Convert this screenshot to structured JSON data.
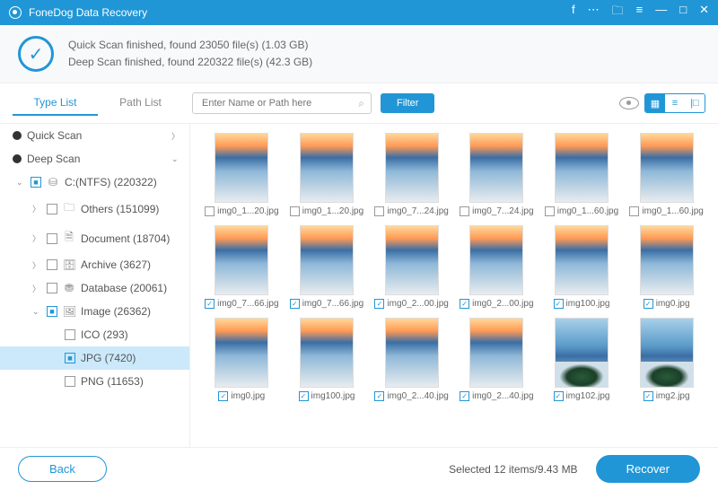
{
  "app": {
    "title": "FoneDog Data Recovery"
  },
  "titlebar_icons": [
    "facebook-icon",
    "feedback-icon",
    "save-icon",
    "menu-icon",
    "minimize-icon",
    "maximize-icon",
    "close-icon"
  ],
  "status": {
    "line1": "Quick Scan finished, found 23050 file(s) (1.03 GB)",
    "line2": "Deep Scan finished, found 220322 file(s) (42.3 GB)"
  },
  "tabs": {
    "type": "Type List",
    "path": "Path List"
  },
  "search": {
    "placeholder": "Enter Name or Path here"
  },
  "filter": "Filter",
  "sidebar": {
    "quick": "Quick Scan",
    "deep": "Deep Scan",
    "drive": "C:(NTFS) (220322)",
    "others": "Others (151099)",
    "document": "Document (18704)",
    "archive": "Archive (3627)",
    "database": "Database (20061)",
    "image": "Image (26362)",
    "ico": "ICO (293)",
    "jpg": "JPG (7420)",
    "png": "PNG (11653)"
  },
  "files": [
    {
      "name": "img0_1...20.jpg",
      "checked": false,
      "alt": false
    },
    {
      "name": "img0_1...20.jpg",
      "checked": false,
      "alt": false
    },
    {
      "name": "img0_7...24.jpg",
      "checked": false,
      "alt": false
    },
    {
      "name": "img0_7...24.jpg",
      "checked": false,
      "alt": false
    },
    {
      "name": "img0_1...60.jpg",
      "checked": false,
      "alt": false
    },
    {
      "name": "img0_1...60.jpg",
      "checked": false,
      "alt": false
    },
    {
      "name": "img0_7...66.jpg",
      "checked": true,
      "alt": false
    },
    {
      "name": "img0_7...66.jpg",
      "checked": true,
      "alt": false
    },
    {
      "name": "img0_2...00.jpg",
      "checked": true,
      "alt": false
    },
    {
      "name": "img0_2...00.jpg",
      "checked": true,
      "alt": false
    },
    {
      "name": "img100.jpg",
      "checked": true,
      "alt": false
    },
    {
      "name": "img0.jpg",
      "checked": true,
      "alt": false
    },
    {
      "name": "img0.jpg",
      "checked": true,
      "alt": false
    },
    {
      "name": "img100.jpg",
      "checked": true,
      "alt": false
    },
    {
      "name": "img0_2...40.jpg",
      "checked": true,
      "alt": false
    },
    {
      "name": "img0_2...40.jpg",
      "checked": true,
      "alt": false
    },
    {
      "name": "img102.jpg",
      "checked": true,
      "alt": true
    },
    {
      "name": "img2.jpg",
      "checked": true,
      "alt": true
    }
  ],
  "footer": {
    "back": "Back",
    "selected": "Selected 12 items/9.43 MB",
    "recover": "Recover"
  }
}
